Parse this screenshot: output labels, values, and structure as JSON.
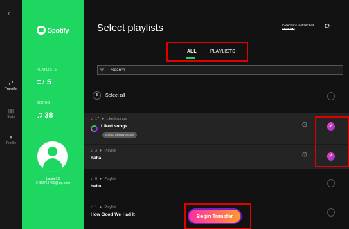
{
  "nav": {
    "back_icon": "chevron-left-icon",
    "items": [
      {
        "label": "Transfer",
        "icon": "transfer-icon",
        "glyph": "⇄",
        "active": true
      },
      {
        "label": "Stats",
        "icon": "stats-icon",
        "glyph": "▥",
        "active": false
      },
      {
        "label": "Profile",
        "icon": "profile-icon",
        "glyph": "●",
        "active": false
      }
    ],
    "logo_icon": "soundwave-logo-icon"
  },
  "sidebar": {
    "brand": "Spotify",
    "brand_icon": "spotify-logo-icon",
    "playlists_label": "PLAYLISTS",
    "playlists_count": "≡♪ 5",
    "songs_label": "SONGS",
    "songs_count": "♫ 38",
    "username": "Laurie12",
    "email": "3489764499@qq.com",
    "accent": "#1ed760"
  },
  "main": {
    "title": "Select playlists",
    "fetched_label": "Collections last fetched",
    "fetched_value": "10:59AM",
    "refresh_icon": "refresh-icon",
    "tabs": [
      {
        "label": "ALL",
        "active": true
      },
      {
        "label": "PLAYLISTS",
        "active": false
      }
    ],
    "search_placeholder": "Search",
    "select_all": {
      "count": "5",
      "label": "Select all"
    },
    "playlists": [
      {
        "count": "17",
        "kind": "Liked songs",
        "name": "Liked songs",
        "badge": "Using: Library Songs",
        "selected": true,
        "settings": true
      },
      {
        "count": "3",
        "kind": "Playlist",
        "name": "haha",
        "selected": true,
        "settings": true
      },
      {
        "count": "6",
        "kind": "Playlist",
        "name": "hello",
        "selected": false,
        "settings": false
      },
      {
        "count": "1",
        "kind": "Playlist",
        "name": "How Good We Had It",
        "selected": false,
        "settings": false
      }
    ],
    "begin_button": "Begin Transfer",
    "highlight_color": "#e10000"
  }
}
